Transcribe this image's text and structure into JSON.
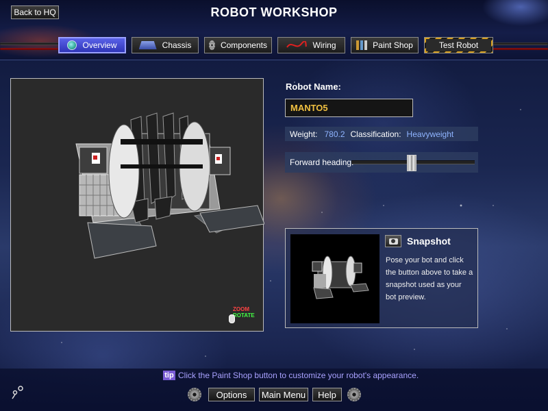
{
  "header": {
    "title": "ROBOT WORKSHOP",
    "back_label": "Back to HQ",
    "tabs": [
      {
        "label": "Overview",
        "icon": "globe-icon",
        "active": true
      },
      {
        "label": "Chassis",
        "icon": "chassis-icon"
      },
      {
        "label": "Components",
        "icon": "gear-icon"
      },
      {
        "label": "Wiring",
        "icon": "wiring-icon"
      },
      {
        "label": "Paint Shop",
        "icon": "paint-icon"
      },
      {
        "label": "Test Robot",
        "icon": null
      }
    ]
  },
  "viewport": {
    "hint_zoom": "ZOOM",
    "hint_rotate": "ROTATE"
  },
  "robot": {
    "name_label": "Robot Name:",
    "name": "MANTO5",
    "weight_label": "Weight:",
    "weight": "780.2",
    "class_label": "Classification:",
    "classification": "Heavyweight",
    "heading_label": "Forward heading:",
    "heading_fraction": 0.49
  },
  "snapshot": {
    "title": "Snapshot",
    "description": "Pose your bot and click the button above to take a snapshot used as your bot preview."
  },
  "footer": {
    "tip_badge": "tip",
    "tip_text": "Click the Paint Shop button to customize your robot's appearance.",
    "options_label": "Options",
    "main_menu_label": "Main Menu",
    "help_label": "Help"
  },
  "colors": {
    "accent_tab": "#4a52d8",
    "name_text": "#f0c040",
    "stat_value": "#8fb4ff",
    "tip_text": "#a9a2ff"
  }
}
